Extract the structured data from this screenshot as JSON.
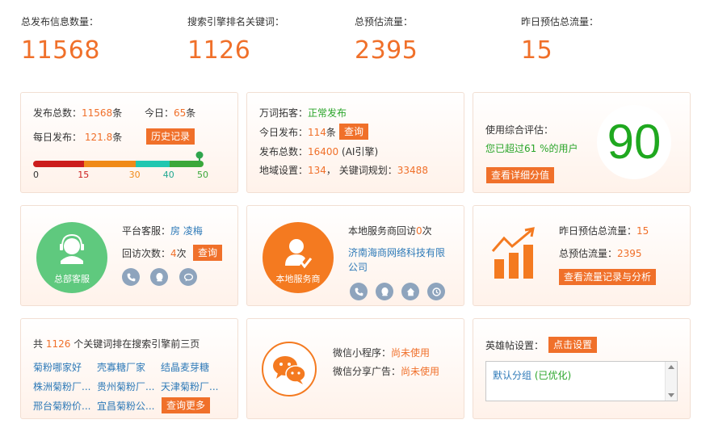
{
  "stats": [
    {
      "label": "总发布信息数量：",
      "value": "11568"
    },
    {
      "label": "搜索引擎排名关键词：",
      "value": "1126"
    },
    {
      "label": "总预估流量：",
      "value": "2395"
    },
    {
      "label": "昨日预估总流量：",
      "value": "15"
    }
  ],
  "card1": {
    "total_label": "发布总数：",
    "total_value": "11568",
    "total_unit": "条",
    "today_label": "今日：",
    "today_value": "65",
    "today_unit": "条",
    "daily_label": "每日发布：",
    "daily_value": "121.8",
    "daily_unit": "条",
    "history_btn": "历史记录",
    "progress": {
      "value": 50,
      "ticks": [
        "0",
        "15",
        "30",
        "40",
        "50"
      ],
      "colors": [
        "#cc1d1d",
        "#f08a18",
        "#20c7b0",
        "#3aa83a"
      ]
    }
  },
  "card2": {
    "wanci_label": "万词拓客：",
    "wanci_value": "正常发布",
    "today_label": "今日发布：",
    "today_value": "114",
    "today_unit": "条",
    "query_btn": "查询",
    "total_label": "发布总数：",
    "total_value": "16400",
    "total_note": "(AI引擎)",
    "region_label": "地域设置：",
    "region_value": "134",
    "sep": "，",
    "kw_label": "关键词规划：",
    "kw_value": "33488"
  },
  "card3": {
    "eval_label": "使用综合评估：",
    "exceed_text": "您已超过61 %的用户",
    "detail_btn": "查看详细分值",
    "score": "90"
  },
  "card4": {
    "icon_label": "总部客服",
    "service_label": "平台客服：",
    "service_name": "房 凌梅",
    "visit_label": "回访次数：",
    "visit_value": "4",
    "visit_unit": "次",
    "query_btn": "查询",
    "accent": "#5fc97e"
  },
  "card5": {
    "icon_label": "本地服务商",
    "visit_text_prefix": "本地服务商回访",
    "visit_value": "0",
    "visit_unit": "次",
    "company": "济南海商网络科技有限公司",
    "accent": "#f47a20"
  },
  "card6": {
    "yesterday_label": "昨日预估总流量：",
    "yesterday_value": "15",
    "total_label": "总预估流量：",
    "total_value": "2395",
    "btn": "查看流量记录与分析"
  },
  "card7": {
    "prefix": "共 ",
    "count": "1126",
    "suffix": " 个关键词排在搜索引擎前三页",
    "keywords": [
      "菊粉哪家好",
      "壳寡糖厂家",
      "结晶麦芽糖",
      "株洲菊粉厂...",
      "贵州菊粉厂...",
      "天津菊粉厂...",
      "邢台菊粉价...",
      "宜昌菊粉公..."
    ],
    "more_btn": "查询更多"
  },
  "card8": {
    "mini_label": "微信小程序：",
    "mini_value": "尚未使用",
    "ad_label": "微信分享广告：",
    "ad_value": "尚未使用"
  },
  "card9": {
    "label": "英雄帖设置：",
    "btn": "点击设置",
    "list_item": "默认分组",
    "list_status": "(已优化)"
  }
}
